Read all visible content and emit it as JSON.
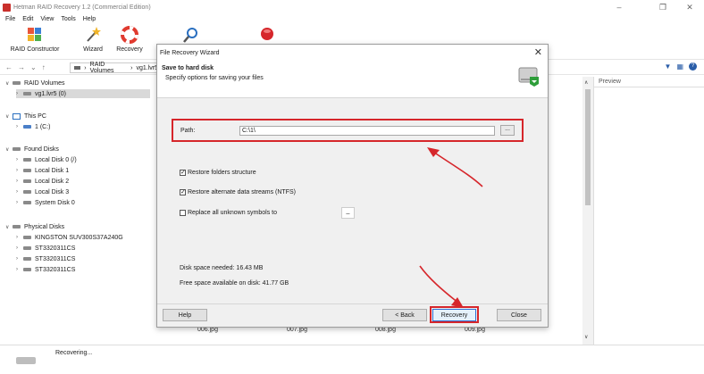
{
  "window": {
    "title": "Hetman RAID Recovery 1.2 (Commercial Edition)",
    "minimize_glyph": "–",
    "restore_glyph": "❐",
    "close_glyph": "✕"
  },
  "menu": [
    "File",
    "Edit",
    "View",
    "Tools",
    "Help"
  ],
  "ribbon": {
    "raid_constructor": "RAID Constructor",
    "wizard": "Wizard",
    "recovery": "Recovery"
  },
  "address": {
    "crumb1": "RAID Volumes",
    "crumb2": "vg1.lvr5"
  },
  "tree": {
    "raid_volumes": "RAID Volumes",
    "raid_vol1": "vg1.lvr5 (0)",
    "this_pc": "This PC",
    "c_drive": "1 (C:)",
    "found_disks": "Found Disks",
    "local0": "Local Disk 0 (/)",
    "local1": "Local Disk 1",
    "local2": "Local Disk 2",
    "local3": "Local Disk 3",
    "system0": "System Disk 0",
    "physical_disks": "Physical Disks",
    "kingston": "KINGSTON SUV300S37A240G",
    "st1": "ST3320311CS",
    "st2": "ST3320311CS",
    "st3": "ST3320311CS"
  },
  "preview": {
    "label": "Preview"
  },
  "files": [
    "006.jpg",
    "007.jpg",
    "008.jpg",
    "009.jpg"
  ],
  "status": {
    "text": "Recovering..."
  },
  "dialog": {
    "title": "File Recovery Wizard",
    "heading": "Save to hard disk",
    "subheading": "Specify options for saving your files",
    "path_label": "Path:",
    "path_value": "C:\\1\\",
    "browse": "...",
    "opt_folders": "Restore folders structure",
    "opt_streams": "Restore alternate data streams (NTFS)",
    "opt_replace": "Replace all unknown symbols to",
    "replace_btn": "_",
    "space_needed": "Disk space needed: 16.43 MB",
    "space_free": "Free space available on disk: 41.77 GB",
    "help": "Help",
    "back": "< Back",
    "recovery": "Recovery",
    "close": "Close"
  },
  "colors": {
    "highlight": "#d6262b",
    "accent": "#2a6fd6"
  }
}
